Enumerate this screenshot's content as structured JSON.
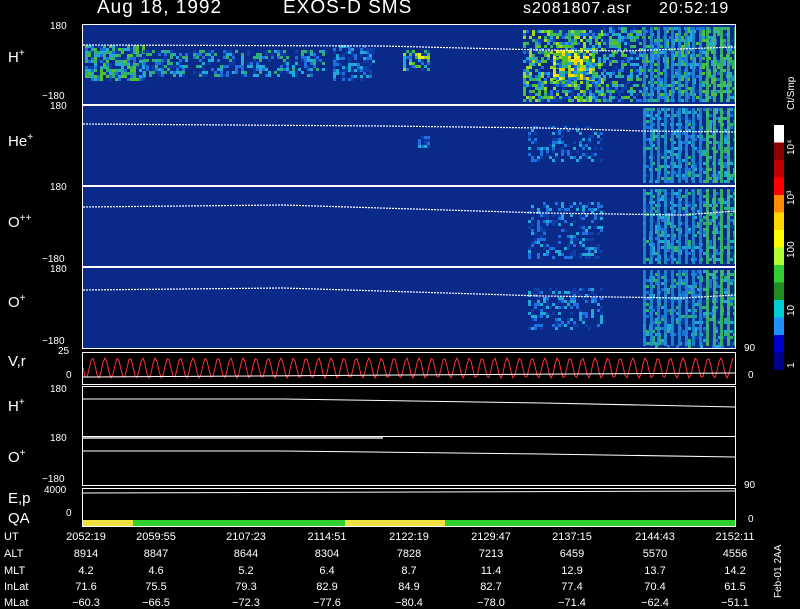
{
  "header": {
    "date": "Aug 18, 1992",
    "instrument": "EXOS-D SMS",
    "file": "s2081807.asr",
    "time": "20:52:19"
  },
  "panels": [
    {
      "id": "h",
      "label": "H",
      "charge": "+",
      "ytop": "180",
      "ybot": "−180"
    },
    {
      "id": "he",
      "label": "He",
      "charge": "+",
      "ytop": "180",
      "ybot": "−180"
    },
    {
      "id": "opp",
      "label": "O",
      "charge": "++",
      "ytop": "180",
      "ybot": "−180"
    },
    {
      "id": "op",
      "label": "O",
      "charge": "+",
      "ytop": "180",
      "ybot": "−180"
    },
    {
      "id": "vr",
      "label": "V,r",
      "charge": "",
      "ytop": "25",
      "ybot": "0",
      "right_top": "90",
      "right_bot": "0"
    },
    {
      "id": "h2",
      "label": "H",
      "charge": "+",
      "ytop": "180",
      "ybot": ""
    },
    {
      "id": "o2",
      "label": "O",
      "charge": "+",
      "ytop": "180",
      "ybot": "−180"
    },
    {
      "id": "ep",
      "label": "E,p",
      "charge": "",
      "ytop": "4000",
      "ybot": "0",
      "right_top": "90",
      "right_bot": "0"
    },
    {
      "id": "qa",
      "label": "QA",
      "charge": ""
    }
  ],
  "colorbar": {
    "unit": "Ct/Smp",
    "ticks": [
      "10⁴",
      "10³",
      "100",
      "10",
      "1"
    ],
    "colors": [
      "#ffffff",
      "#8b0000",
      "#c00000",
      "#ff0000",
      "#ff8c00",
      "#ffd700",
      "#ffff00",
      "#adff2f",
      "#32cd32",
      "#228b22",
      "#00ced1",
      "#1e90ff",
      "#0000cd",
      "#00008b"
    ]
  },
  "table": {
    "rows": [
      {
        "label": "UT",
        "values": [
          "2052:19",
          "2059:55",
          "2107:23",
          "2114:51",
          "2122:19",
          "2129:47",
          "2137:15",
          "2144:43",
          "2152:11"
        ]
      },
      {
        "label": "ALT",
        "values": [
          "8914",
          "8847",
          "8644",
          "8304",
          "7828",
          "7213",
          "6459",
          "5570",
          "4556"
        ]
      },
      {
        "label": "MLT",
        "values": [
          "4.2",
          "4.6",
          "5.2",
          "6.4",
          "8.7",
          "11.4",
          "12.9",
          "13.7",
          "14.2"
        ]
      },
      {
        "label": "InLat",
        "values": [
          "71.6",
          "75.5",
          "79.3",
          "82.9",
          "84.9",
          "82.7",
          "77.4",
          "70.4",
          "61.5"
        ]
      },
      {
        "label": "MLat",
        "values": [
          "−60.3",
          "−66.5",
          "−72.3",
          "−77.6",
          "−80.4",
          "−78.0",
          "−71.4",
          "−62.4",
          "−51.1"
        ]
      }
    ]
  },
  "footer_note": "Feb-01 2AA",
  "chart_data": {
    "type": "heatmap",
    "title": "Aug 18, 1992   EXOS-D SMS",
    "x": [
      "2052:19",
      "2059:55",
      "2107:23",
      "2114:51",
      "2122:19",
      "2129:47",
      "2137:15",
      "2144:43",
      "2152:11"
    ],
    "series": [
      {
        "name": "H+",
        "ylim": [
          -180,
          180
        ]
      },
      {
        "name": "He+",
        "ylim": [
          -180,
          180
        ]
      },
      {
        "name": "O++",
        "ylim": [
          -180,
          180
        ]
      },
      {
        "name": "O+",
        "ylim": [
          -180,
          180
        ]
      },
      {
        "name": "V,r",
        "ylim": [
          0,
          25
        ]
      },
      {
        "name": "H+",
        "ylim": [
          -180,
          180
        ]
      },
      {
        "name": "O+",
        "ylim": [
          -180,
          180
        ]
      },
      {
        "name": "E,p",
        "ylim": [
          0,
          4000
        ]
      }
    ],
    "qa_flags": [
      {
        "from": "2052:19",
        "to": "2059:55",
        "status": "yellow"
      },
      {
        "from": "2059:55",
        "to": "2114:51",
        "status": "green"
      },
      {
        "from": "2114:51",
        "to": "2124:00",
        "status": "yellow"
      },
      {
        "from": "2124:00",
        "to": "2152:11",
        "status": "green"
      }
    ],
    "colorscale_label": "Ct/Smp"
  }
}
